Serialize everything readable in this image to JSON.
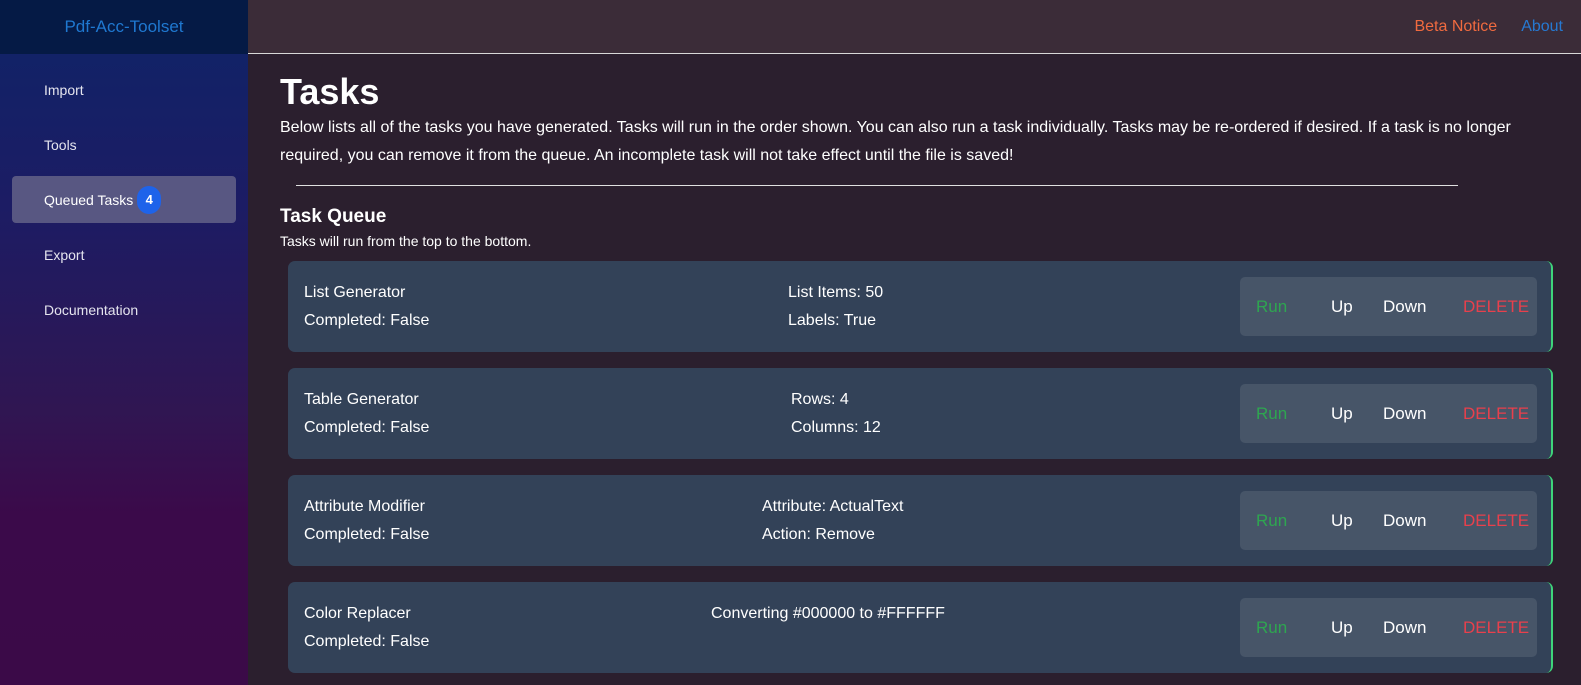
{
  "app": {
    "title": "Pdf-Acc-Toolset"
  },
  "topbar": {
    "beta_label": "Beta Notice",
    "about_label": "About"
  },
  "sidebar": {
    "items": [
      {
        "label": "Import",
        "active": false
      },
      {
        "label": "Tools",
        "active": false
      },
      {
        "label": "Queued Tasks",
        "active": true,
        "badge": "4"
      },
      {
        "label": "Export",
        "active": false
      },
      {
        "label": "Documentation",
        "active": false
      }
    ]
  },
  "main": {
    "title": "Tasks",
    "intro": "Below lists all of the tasks you have generated. Tasks will run in the order shown. You can also run a task individually. Tasks may be re-ordered if desired. If a task is no longer required, you can remove it from the queue. An incomplete task will not take effect until the file is saved!",
    "queue_title": "Task Queue",
    "queue_subtitle": "Tasks will run from the top to the bottom.",
    "actions": {
      "run": "Run",
      "up": "Up",
      "down": "Down",
      "delete": "DELETE"
    },
    "tasks": [
      {
        "name": "List Generator",
        "status": "Completed: False",
        "details": [
          "List Items: 50",
          "Labels: True"
        ]
      },
      {
        "name": "Table Generator",
        "status": "Completed: False",
        "details": [
          "Rows: 4",
          "Columns: 12"
        ]
      },
      {
        "name": "Attribute Modifier",
        "status": "Completed: False",
        "details": [
          "Attribute: ActualText",
          "Action: Remove"
        ]
      },
      {
        "name": "Color Replacer",
        "status": "Completed: False",
        "details": [
          "Converting #000000 to #FFFFFF"
        ]
      }
    ]
  },
  "colors": {
    "brand": "#1f78d0",
    "beta": "#f06a3f",
    "about": "#2679d2",
    "badge": "#1e63ea",
    "run": "#2ea650",
    "delete": "#e8404c",
    "card_border": "#3ed47a"
  }
}
